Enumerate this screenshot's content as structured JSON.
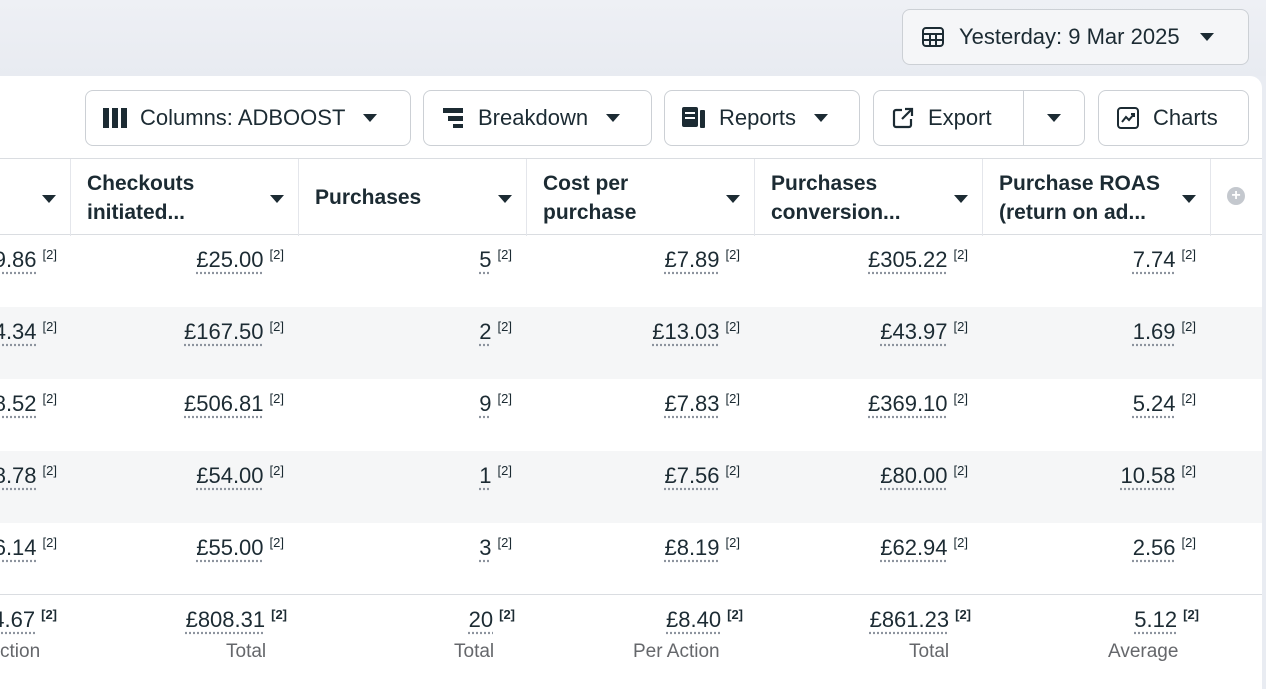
{
  "date_range": {
    "label": "Yesterday: 9 Mar 2025",
    "icon": "calendar-icon"
  },
  "toolbar": {
    "columns": "Columns: ADBOOST",
    "breakdown": "Breakdown",
    "reports": "Reports",
    "export": "Export",
    "charts": "Charts"
  },
  "columns": [
    {
      "label": ""
    },
    {
      "label": "Checkouts initiated..."
    },
    {
      "label": "Purchases"
    },
    {
      "label": "Cost per purchase"
    },
    {
      "label": "Purchases conversion..."
    },
    {
      "label": "Purchase ROAS (return on ad..."
    }
  ],
  "rows": [
    [
      "9.86",
      "£25.00",
      "5",
      "£7.89",
      "£305.22",
      "7.74"
    ],
    [
      "4.34",
      "£167.50",
      "2",
      "£13.03",
      "£43.97",
      "1.69"
    ],
    [
      "8.52",
      "£506.81",
      "9",
      "£7.83",
      "£369.10",
      "5.24"
    ],
    [
      "8.78",
      "£54.00",
      "1",
      "£7.56",
      "£80.00",
      "10.58"
    ],
    [
      "6.14",
      "£55.00",
      "3",
      "£8.19",
      "£62.94",
      "2.56"
    ]
  ],
  "footnote": "[2]",
  "totals": {
    "values": [
      "4.67",
      "£808.31",
      "20",
      "£8.40",
      "£861.23",
      "5.12"
    ],
    "labels": [
      "ction",
      "Total",
      "Total",
      "Per Action",
      "Total",
      "Average"
    ]
  }
}
